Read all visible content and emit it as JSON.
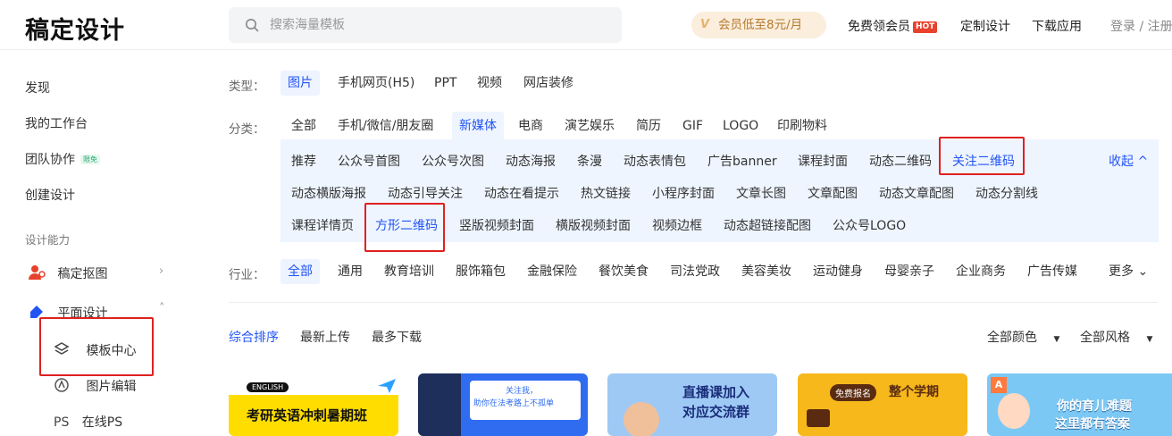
{
  "header": {
    "logo": "稿定设计",
    "search_placeholder": "搜索海量模板",
    "vip_text": "会员低至8元/月",
    "vip_logo": "Vip",
    "free_vip": "免费领会员",
    "hot_badge": "HOT",
    "custom_design": "定制设计",
    "download_app": "下载应用",
    "login": "登录 / 注册"
  },
  "sidebar": {
    "discover": "发现",
    "workspace": "我的工作台",
    "team": "团队协作",
    "team_badge": "限免",
    "create": "创建设计",
    "section": "设计能力",
    "matting": "稿定抠图",
    "graphic": "平面设计",
    "template_center": "模板中心",
    "image_edit": "图片编辑",
    "online_ps": "在线PS",
    "ps_glyph": "PS"
  },
  "filters": {
    "type_label": "类型：",
    "types": [
      "图片",
      "手机网页(H5)",
      "PPT",
      "视频",
      "网店装修"
    ],
    "category_label": "分类：",
    "categories": [
      "全部",
      "手机/微信/朋友圈",
      "新媒体",
      "电商",
      "演艺娱乐",
      "简历",
      "GIF",
      "LOGO",
      "印刷物料"
    ],
    "sub_row1": [
      "推荐",
      "公众号首图",
      "公众号次图",
      "动态海报",
      "条漫",
      "动态表情包",
      "广告banner",
      "课程封面",
      "动态二维码",
      "关注二维码"
    ],
    "sub_row2": [
      "动态横版海报",
      "动态引导关注",
      "动态在看提示",
      "热文链接",
      "小程序封面",
      "文章长图",
      "文章配图",
      "动态文章配图",
      "动态分割线"
    ],
    "sub_row3": [
      "课程详情页",
      "方形二维码",
      "竖版视频封面",
      "横版视频封面",
      "视频边框",
      "动态超链接配图",
      "公众号LOGO"
    ],
    "collapse": "收起 ^",
    "industry_label": "行业：",
    "industries": [
      "全部",
      "通用",
      "教育培训",
      "服饰箱包",
      "金融保险",
      "餐饮美食",
      "司法党政",
      "美容美妆",
      "运动健身",
      "母婴亲子",
      "企业商务",
      "广告传媒"
    ],
    "more": "更多 ⌄"
  },
  "sort": {
    "options": [
      "综合排序",
      "最新上传",
      "最多下载"
    ],
    "color": "全部颜色",
    "style": "全部风格"
  },
  "cards": [
    {
      "line1": "ENGLISH",
      "title": "考研英语冲刺暑期班"
    },
    {
      "line1": "关注我，",
      "title": "助你在法考路上不孤单"
    },
    {
      "line1": "直播课加入",
      "title": "对应交流群"
    },
    {
      "line1": "免费报名",
      "title": "整个学期"
    },
    {
      "line1": "你的育儿难题",
      "title": "这里都有答案"
    }
  ]
}
